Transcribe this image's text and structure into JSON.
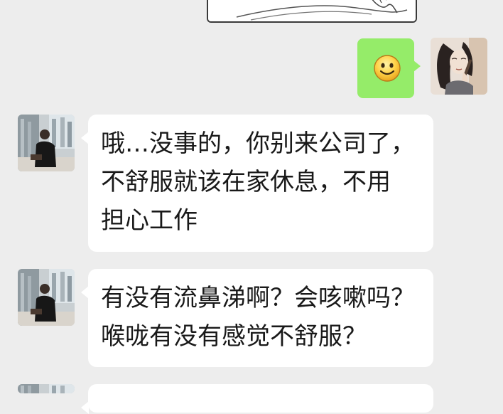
{
  "messages": {
    "incoming_1": {
      "lines": [
        "哦…没事的，你别来公司了，",
        "不舒服就该在家休息，不用",
        "担心工作"
      ]
    },
    "incoming_2": {
      "lines": [
        "有没有流鼻涕啊？会咳嗽吗？",
        "喉咙有没有感觉不舒服？"
      ]
    }
  },
  "icons": {
    "emoji": "smiley-emoji-icon",
    "self_avatar": "avatar-woman-sketch",
    "other_avatar": "avatar-man-office"
  },
  "colors": {
    "background": "#ededed",
    "outgoing_bubble": "#95ec69",
    "incoming_bubble": "#ffffff",
    "text": "#191919"
  }
}
